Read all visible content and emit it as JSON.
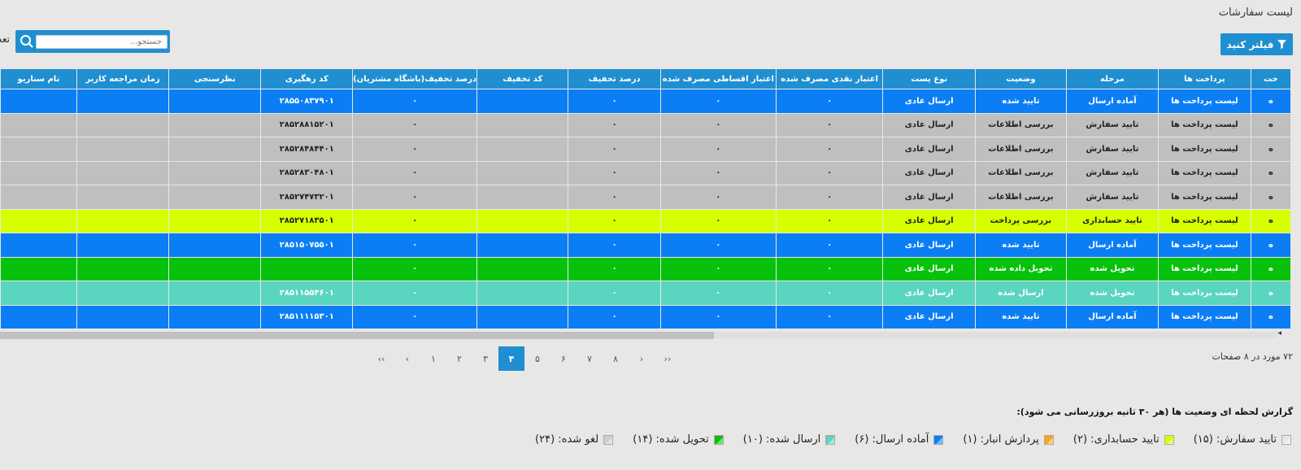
{
  "page": {
    "title": "لیست سفارشات"
  },
  "toolbar": {
    "filter_label": "فیلتر کنید",
    "filter_icon": "filter-icon"
  },
  "search": {
    "placeholder": "جستجو...",
    "icon": "search-icon",
    "label": "تعداد"
  },
  "table": {
    "columns": [
      "خت",
      "پرداخت ها",
      "مرحله",
      "وضعیت",
      "نوع پست",
      "اعتبار نقدی مصرف شده",
      "اعتبار اقساطی مصرف شده",
      "درصد تخفیف",
      "کد تخفیف",
      "درصد تخفیف(باشگاه مشتریان)",
      "کد رهگیری",
      "نظرسنجی",
      "زمان مراجعه کاربر",
      "نام سناریو"
    ],
    "rows": [
      {
        "status": "blue",
        "cells": [
          "ه",
          "لیست پرداخت ها",
          "آماده ارسال",
          "تایید شده",
          "ارسال عادی",
          "۰",
          "۰",
          "۰",
          "",
          "۰",
          "۲۸۵۵۰۸۳۷۹۰۱",
          "",
          "",
          ""
        ]
      },
      {
        "status": "gray",
        "cells": [
          "ه",
          "لیست پرداخت ها",
          "تایید سفارش",
          "بررسی اطلاعات",
          "ارسال عادی",
          "۰",
          "۰",
          "۰",
          "",
          "۰",
          "۲۸۵۲۸۸۱۵۲۰۱",
          "",
          "",
          ""
        ]
      },
      {
        "status": "gray",
        "cells": [
          "ه",
          "لیست پرداخت ها",
          "تایید سفارش",
          "بررسی اطلاعات",
          "ارسال عادی",
          "۰",
          "۰",
          "۰",
          "",
          "۰",
          "۲۸۵۲۸۴۸۴۴۰۱",
          "",
          "",
          ""
        ]
      },
      {
        "status": "gray",
        "cells": [
          "ه",
          "لیست پرداخت ها",
          "تایید سفارش",
          "بررسی اطلاعات",
          "ارسال عادی",
          "۰",
          "۰",
          "۰",
          "",
          "۰",
          "۲۸۵۲۸۳۰۴۸۰۱",
          "",
          "",
          ""
        ]
      },
      {
        "status": "gray",
        "cells": [
          "ه",
          "لیست پرداخت ها",
          "تایید سفارش",
          "بررسی اطلاعات",
          "ارسال عادی",
          "۰",
          "۰",
          "۰",
          "",
          "۰",
          "۲۸۵۲۷۴۷۳۲۰۱",
          "",
          "",
          ""
        ]
      },
      {
        "status": "yellow",
        "cells": [
          "ه",
          "لیست پرداخت ها",
          "تایید حسابداری",
          "بررسی پرداخت",
          "ارسال عادی",
          "۰",
          "۰",
          "۰",
          "",
          "۰",
          "۲۸۵۲۷۱۸۳۵۰۱",
          "",
          "",
          ""
        ]
      },
      {
        "status": "blue",
        "cells": [
          "ه",
          "لیست پرداخت ها",
          "آماده ارسال",
          "تایید شده",
          "ارسال عادی",
          "۰",
          "۰",
          "۰",
          "",
          "۰",
          "۲۸۵۱۵۰۷۵۵۰۱",
          "",
          "",
          ""
        ]
      },
      {
        "status": "green",
        "cells": [
          "ه",
          "لیست پرداخت ها",
          "تحویل شده",
          "تحویل داده شده",
          "ارسال عادی",
          "۰",
          "۰",
          "۰",
          "",
          "۰",
          "",
          "",
          "",
          ""
        ]
      },
      {
        "status": "teal",
        "cells": [
          "ه",
          "لیست پرداخت ها",
          "تحویل شده",
          "ارسال شده",
          "ارسال عادی",
          "۰",
          "۰",
          "۰",
          "",
          "۰",
          "۲۸۵۱۱۵۵۴۶۰۱",
          "",
          "",
          ""
        ]
      },
      {
        "status": "blue",
        "cells": [
          "ه",
          "لیست پرداخت ها",
          "آماده ارسال",
          "تایید شده",
          "ارسال عادی",
          "۰",
          "۰",
          "۰",
          "",
          "۰",
          "۲۸۵۱۱۱۱۵۳۰۱",
          "",
          "",
          ""
        ]
      }
    ]
  },
  "pagination": {
    "info": "۷۲ مورد در ۸ صفحات",
    "items": [
      "‹‹",
      "‹",
      "۱",
      "۲",
      "۳",
      "۴",
      "۵",
      "۶",
      "۷",
      "۸",
      "›",
      "››"
    ],
    "active_page": "۴"
  },
  "report": {
    "title": "گزارش لحظه ای وضعیت ها (هر ۳۰ ثانیه بروزرسانی می شود):",
    "legend": [
      {
        "label": "تایید سفارش: (۱۵)",
        "color": "#e8e7e5"
      },
      {
        "label": "تایید حسابداری: (۲)",
        "color": "#d7ff00"
      },
      {
        "label": "پردازش انبار: (۱)",
        "color": "#f7a520"
      },
      {
        "label": "آماده ارسال: (۶)",
        "color": "#0c7ef5"
      },
      {
        "label": "ارسال شده: (۱۰)",
        "color": "#5ad5bf"
      },
      {
        "label": "تحویل شده: (۱۴)",
        "color": "#08c10c"
      },
      {
        "label": "لغو شده: (۲۴)",
        "color": "#cfcfcf"
      }
    ]
  }
}
